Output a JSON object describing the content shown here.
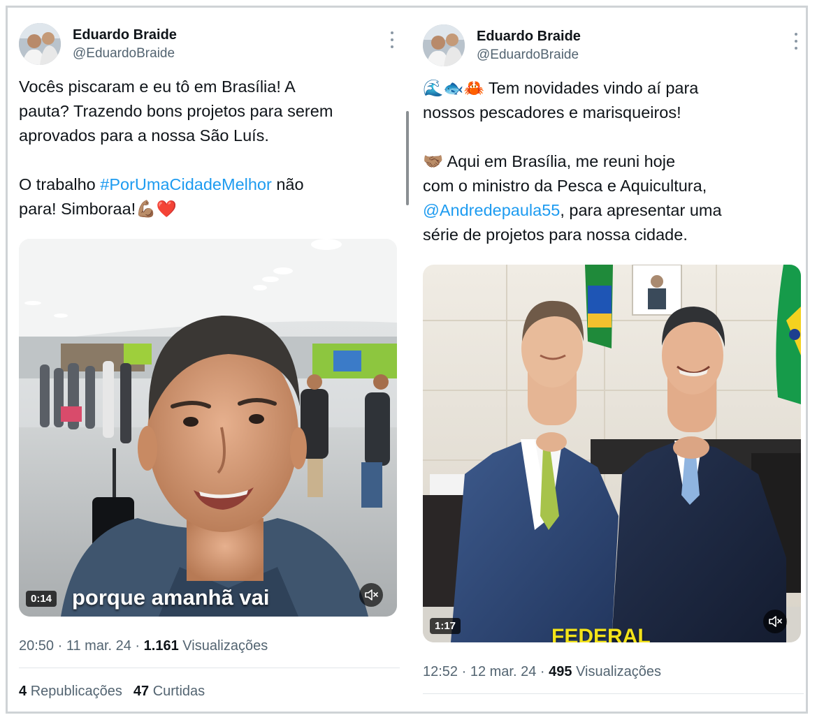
{
  "left_tweet": {
    "name": "Eduardo Braide",
    "handle": "@EduardoBraide",
    "text": {
      "line1": "Vocês piscaram e eu tô em Brasília! A",
      "line2": "pauta? Trazendo bons projetos para serem",
      "line3": "aprovados para a nossa São Luís.",
      "line4_prefix": "O trabalho ",
      "hashtag": "#PorUmaCidadeMelhor",
      "line4_suffix": " não",
      "line5": "para! Simboraa!💪🏽❤️"
    },
    "video": {
      "duration": "0:14",
      "caption": "porque amanhã vai",
      "mute_icon": "speaker-muted-icon"
    },
    "time": "20:50",
    "date": "11 mar. 24",
    "views_count": "1.161",
    "views_label": "Visualizações",
    "reposts_count": "4",
    "reposts_label": "Republicações",
    "likes_count": "47",
    "likes_label": "Curtidas"
  },
  "right_tweet": {
    "name": "Eduardo Braide",
    "handle": "@EduardoBraide",
    "text": {
      "line1": "🌊🐟🦀 Tem novidades vindo aí para",
      "line2": "nossos pescadores e marisqueiros!",
      "line3": "🤝🏽 Aqui em Brasília, me reuni hoje",
      "line4": "com o ministro da Pesca e Aquicultura,",
      "mention": "@Andredepaula55",
      "line5_suffix": ", para apresentar uma",
      "line6": "série de projetos para nossa cidade."
    },
    "video": {
      "duration": "1:17",
      "caption": "FEDERAL",
      "mute_icon": "speaker-muted-icon"
    },
    "time": "12:52",
    "date": "12 mar. 24",
    "views_count": "495",
    "views_label": "Visualizações"
  },
  "separator": " · ",
  "colors": {
    "link": "#1d9bf0",
    "secondary_text": "#536471",
    "primary_text": "#0f1419"
  }
}
